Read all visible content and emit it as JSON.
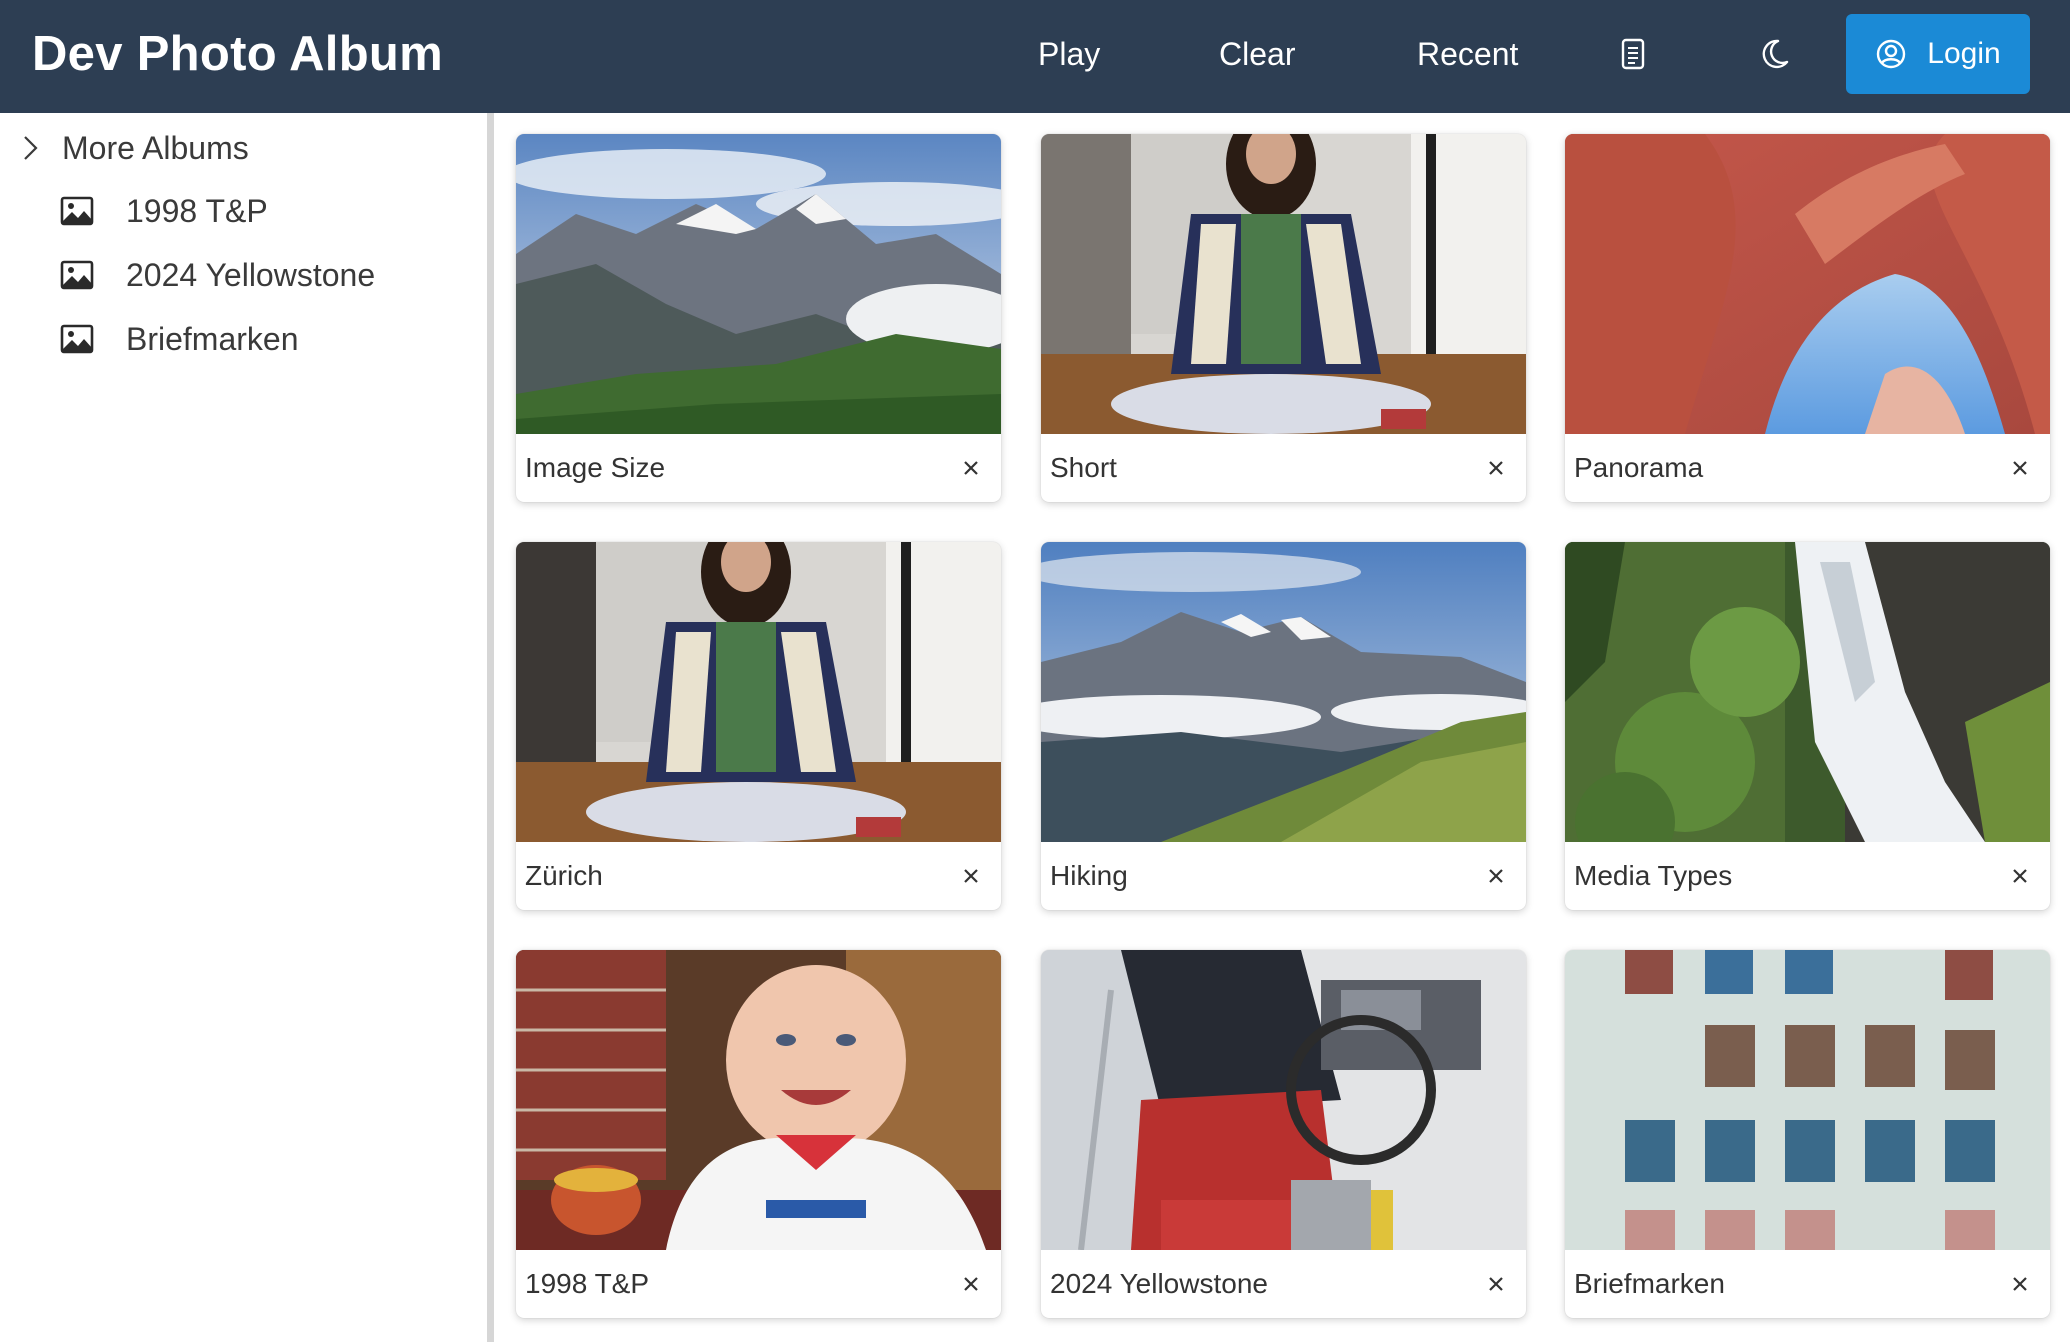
{
  "header": {
    "title": "Dev Photo Album",
    "nav": {
      "play": "Play",
      "clear": "Clear",
      "recent": "Recent"
    },
    "login_label": "Login",
    "colors": {
      "bar": "#2d3e53",
      "login": "#1b8ad6"
    }
  },
  "sidebar": {
    "more_albums": "More Albums",
    "albums": [
      {
        "label": "1998 T&P",
        "icon": "image-icon"
      },
      {
        "label": "2024 Yellowstone",
        "icon": "image-icon"
      },
      {
        "label": "Briefmarken",
        "icon": "image-icon"
      }
    ]
  },
  "gallery": {
    "cards": [
      {
        "caption": "Image Size",
        "subject": "mountain-landscape"
      },
      {
        "caption": "Short",
        "subject": "child-sitting"
      },
      {
        "caption": "Panorama",
        "subject": "slot-canyon"
      },
      {
        "caption": "Zürich",
        "subject": "child-sitting"
      },
      {
        "caption": "Hiking",
        "subject": "mountain-valley"
      },
      {
        "caption": "Media Types",
        "subject": "waterfall"
      },
      {
        "caption": "1998 T&P",
        "subject": "baby"
      },
      {
        "caption": "2024 Yellowstone",
        "subject": "boat-helm"
      },
      {
        "caption": "Briefmarken",
        "subject": "stamps"
      }
    ]
  }
}
